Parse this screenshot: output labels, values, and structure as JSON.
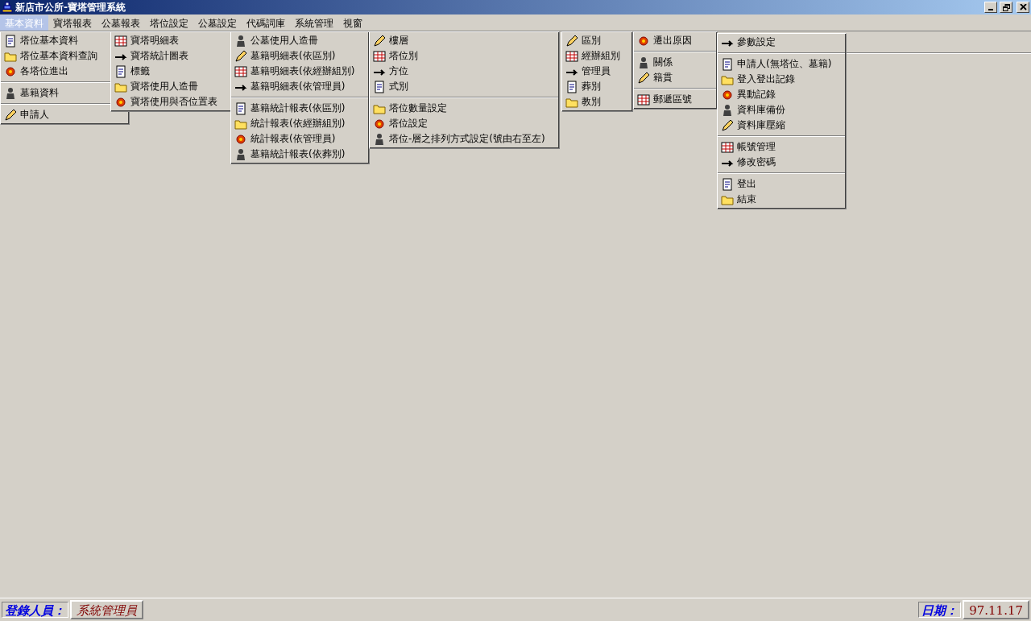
{
  "window": {
    "title": "新店市公所-寶塔管理系統"
  },
  "menu_bar": [
    {
      "label": "基本資料",
      "selected": true
    },
    {
      "label": "寶塔報表",
      "selected": false
    },
    {
      "label": "公墓報表",
      "selected": false
    },
    {
      "label": "塔位設定",
      "selected": false
    },
    {
      "label": "公墓設定",
      "selected": false
    },
    {
      "label": "代碼詞庫",
      "selected": false
    },
    {
      "label": "系統管理",
      "selected": false
    },
    {
      "label": "視窗",
      "selected": false
    }
  ],
  "open_menus": [
    {
      "items": [
        {
          "kind": "item",
          "label": "塔位基本資料"
        },
        {
          "kind": "item",
          "label": "塔位基本資料查詢"
        },
        {
          "kind": "item",
          "label": "各塔位進出"
        },
        {
          "kind": "separator"
        },
        {
          "kind": "item",
          "label": "墓籍資料"
        },
        {
          "kind": "separator"
        },
        {
          "kind": "item",
          "label": "申請人"
        }
      ]
    },
    {
      "items": [
        {
          "kind": "item",
          "label": "寶塔明細表"
        },
        {
          "kind": "item",
          "label": "寶塔統計圖表"
        },
        {
          "kind": "item",
          "label": "標籤"
        },
        {
          "kind": "item",
          "label": "寶塔使用人造冊"
        },
        {
          "kind": "item",
          "label": "寶塔使用與否位置表"
        }
      ]
    },
    {
      "items": [
        {
          "kind": "item",
          "label": "公墓使用人造冊"
        },
        {
          "kind": "item",
          "label": "墓籍明細表(依區別)"
        },
        {
          "kind": "item",
          "label": "墓籍明細表(依經辦組別)"
        },
        {
          "kind": "item",
          "label": "墓籍明細表(依管理員)"
        },
        {
          "kind": "separator"
        },
        {
          "kind": "item",
          "label": "墓籍統計報表(依區別)"
        },
        {
          "kind": "item",
          "label": "統計報表(依經辦組別)"
        },
        {
          "kind": "item",
          "label": "統計報表(依管理員)"
        },
        {
          "kind": "item",
          "label": "墓籍統計報表(依葬別)"
        }
      ]
    },
    {
      "items": [
        {
          "kind": "item",
          "label": "樓層"
        },
        {
          "kind": "item",
          "label": "塔位別"
        },
        {
          "kind": "item",
          "label": "方位"
        },
        {
          "kind": "item",
          "label": "式別"
        },
        {
          "kind": "separator"
        },
        {
          "kind": "item",
          "label": "塔位數量設定"
        },
        {
          "kind": "item",
          "label": "塔位設定"
        },
        {
          "kind": "item",
          "label": "塔位-層之排列方式設定(號由右至左)"
        }
      ]
    },
    {
      "items": [
        {
          "kind": "item",
          "label": "區別"
        },
        {
          "kind": "item",
          "label": "經辦組別"
        },
        {
          "kind": "item",
          "label": "管理員"
        },
        {
          "kind": "item",
          "label": "葬別"
        },
        {
          "kind": "item",
          "label": "教別"
        }
      ]
    },
    {
      "items": [
        {
          "kind": "item",
          "label": "遷出原因"
        },
        {
          "kind": "separator"
        },
        {
          "kind": "item",
          "label": "關係"
        },
        {
          "kind": "item",
          "label": "籍貫"
        },
        {
          "kind": "separator"
        },
        {
          "kind": "item",
          "label": "郵遞區號"
        }
      ]
    },
    {
      "items": [
        {
          "kind": "item",
          "label": "參數設定"
        },
        {
          "kind": "separator"
        },
        {
          "kind": "item",
          "label": "申請人(無塔位、墓籍)"
        },
        {
          "kind": "item",
          "label": "登入登出記錄"
        },
        {
          "kind": "item",
          "label": "異動記錄"
        },
        {
          "kind": "item",
          "label": "資料庫備份"
        },
        {
          "kind": "item",
          "label": "資料庫壓縮"
        },
        {
          "kind": "separator"
        },
        {
          "kind": "item",
          "label": "帳號管理"
        },
        {
          "kind": "item",
          "label": "修改密碼"
        },
        {
          "kind": "separator"
        },
        {
          "kind": "item",
          "label": "登出"
        },
        {
          "kind": "item",
          "label": "結束"
        }
      ]
    }
  ],
  "status_bar": {
    "user_label": "登錄人員：",
    "user": "系統管理員",
    "date_label": "日期：",
    "date": "97.11.17"
  }
}
